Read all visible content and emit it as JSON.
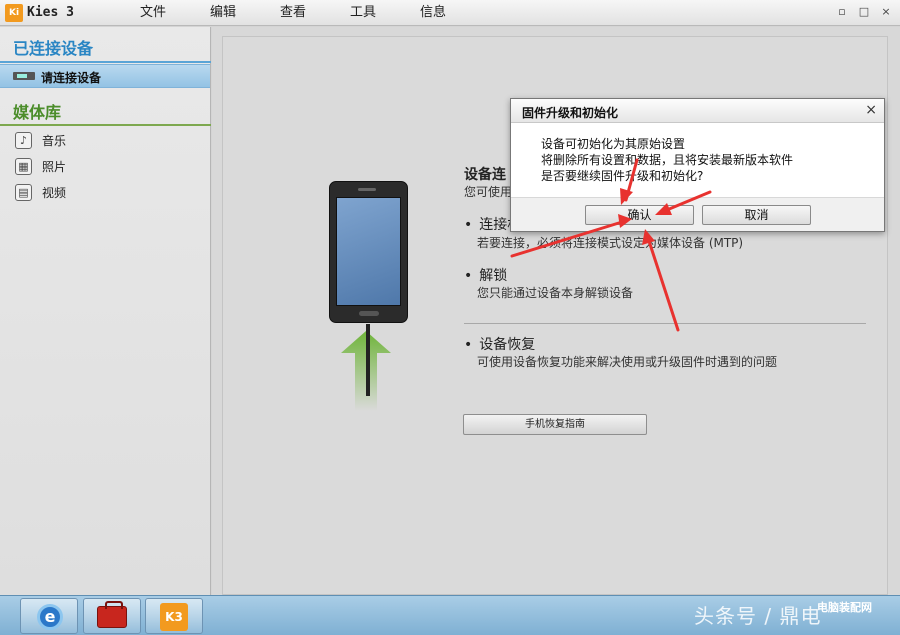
{
  "app": {
    "logo": "Ki",
    "title": "Kies 3"
  },
  "menu": [
    "文件",
    "编辑",
    "查看",
    "工具",
    "信息"
  ],
  "window_controls": [
    "▫",
    "□",
    "×"
  ],
  "sidebar": {
    "connected_title": "已连接设备",
    "device_label": "请连接设备",
    "library_title": "媒体库",
    "media_items": [
      {
        "label": "音乐",
        "icon": "music-icon"
      },
      {
        "label": "照片",
        "icon": "photo-icon"
      },
      {
        "label": "视频",
        "icon": "video-icon"
      }
    ]
  },
  "main": {
    "heading": "设备连",
    "subheading": "您可使用",
    "items": [
      {
        "title": "连接机",
        "desc": "若要连接，必须将连接模式设定为媒体设备 (MTP)"
      },
      {
        "title": "解锁",
        "desc": "您只能通过设备本身解锁设备"
      },
      {
        "title": "设备恢复",
        "desc": "可使用设备恢复功能来解决使用或升级固件时遇到的问题"
      }
    ],
    "guide_button": "手机恢复指南"
  },
  "dialog": {
    "title": "固件升级和初始化",
    "close": "×",
    "lines": [
      "设备可初始化为其原始设置",
      "将删除所有设置和数据，且将安装最新版本软件",
      "是否要继续固件升级和初始化?"
    ],
    "confirm": "确认",
    "cancel": "取消"
  },
  "taskbar": {
    "ie_glyph": "e",
    "kies_glyph": "K3"
  },
  "watermark": {
    "text": "头条号 / 鼎电",
    "site": "电脑装配网"
  },
  "colors": {
    "accent_blue": "#2a86c4",
    "library_green": "#4b8d2a",
    "arrow_red": "#e8322f",
    "selection": "#93c3e4"
  }
}
